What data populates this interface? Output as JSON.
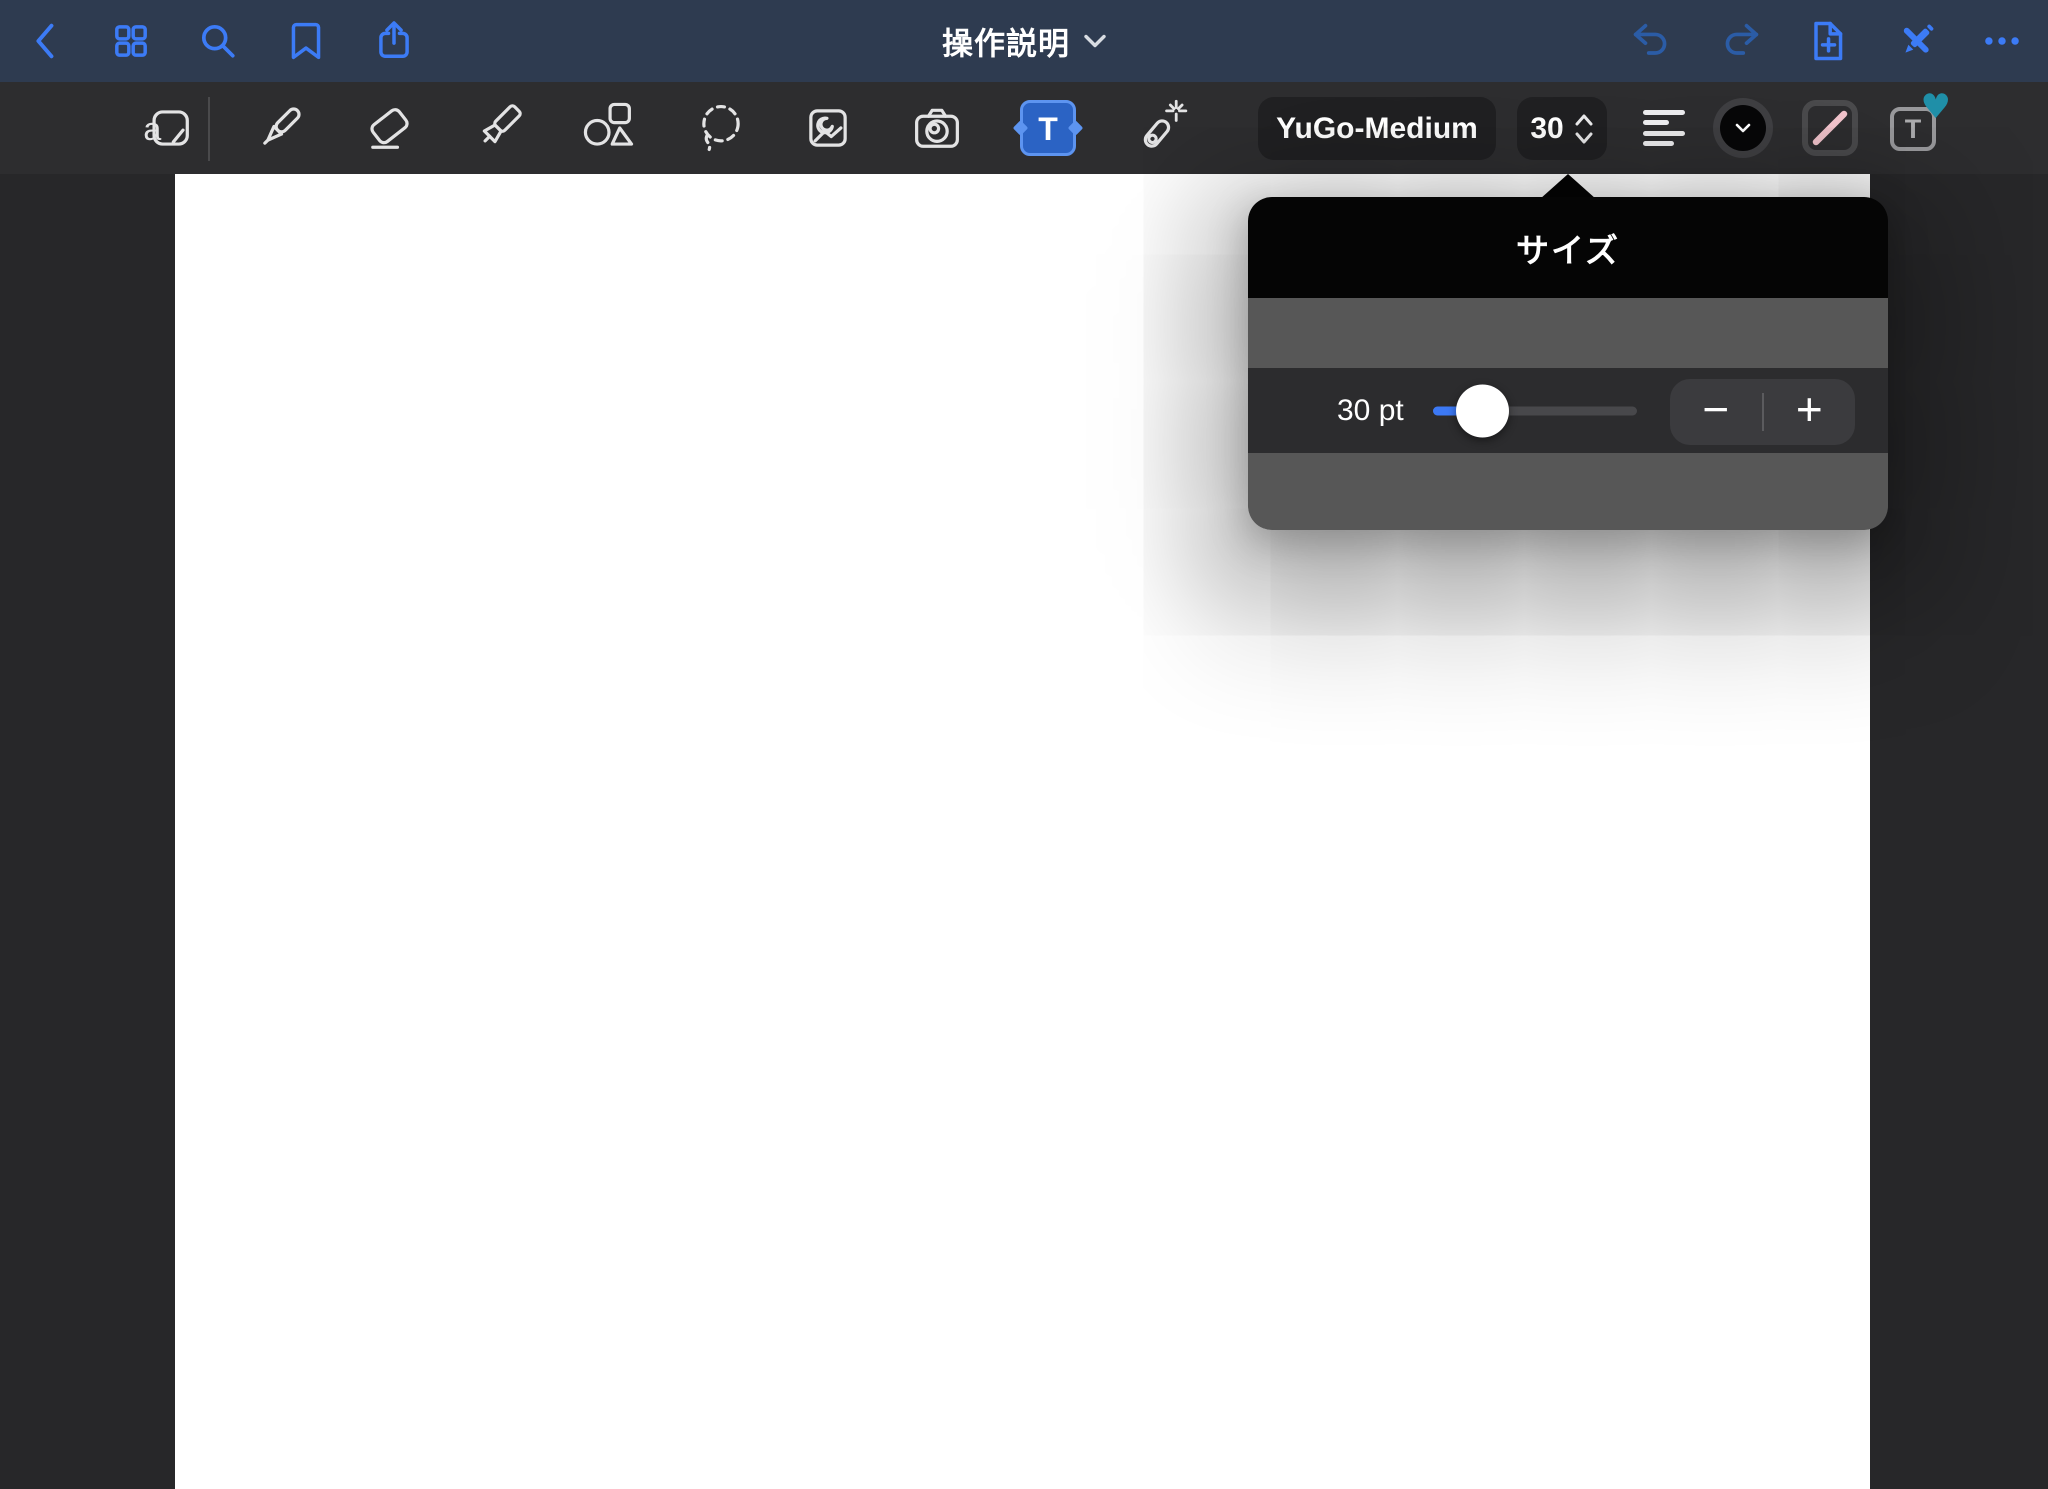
{
  "nav": {
    "title": "操作説明",
    "left_icons": [
      "back-chevron",
      "grid-view",
      "search",
      "bookmark",
      "share"
    ],
    "right_icons": [
      "undo",
      "redo",
      "add-page",
      "pencil-cross",
      "more-ellipsis"
    ],
    "undo_enabled": false,
    "redo_enabled": false
  },
  "toolbar": {
    "tools": [
      "read-only-mode",
      "pen",
      "eraser",
      "highlighter",
      "shapes",
      "lasso",
      "insert-image",
      "camera",
      "text",
      "laser-pointer"
    ],
    "selected_tool": "text",
    "font_label": "YuGo-Medium",
    "size_label": "30",
    "text_tool_letter": "T",
    "favorite_letter": "T",
    "text_controls": [
      "font",
      "size",
      "alignment",
      "text-color",
      "fill-color",
      "favorite-style"
    ]
  },
  "icons": {
    "readonly_letter": "a",
    "favorite_badge": "heart",
    "color_selected": "black",
    "fill_selected": "none"
  },
  "popover": {
    "title": "サイズ",
    "size_value": "30 pt",
    "minus": "−",
    "plus": "+",
    "slider": {
      "value_pt": 30,
      "percent_along_track": 24
    }
  },
  "colors": {
    "nav-bg": "#2E3B50",
    "accent": "#3C7BF6",
    "accent-dim": "#2B5CA6",
    "toolbar-bg": "#2D2D2F",
    "toolbar-icon": "#E3E3E4",
    "canvas-outside": "#272729",
    "page-bg": "#FFFFFF",
    "popover-header": "#050505",
    "popover-band": "#575757",
    "popover-row": "#2C2C2E",
    "stepper-bg": "#3B3B3E",
    "slider-fill": "#3C79F5",
    "slider-track": "#48484B",
    "text-tool-fill": "#2B63C4",
    "text-tool-border": "#5D94F0",
    "swatch-line": "#F1C3CB",
    "heart": "#1F8FA8"
  }
}
